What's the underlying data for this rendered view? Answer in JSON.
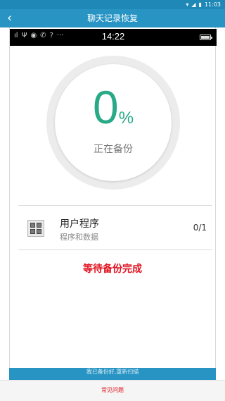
{
  "status_bar": {
    "time": "11:03",
    "icons": [
      "wifi-icon",
      "signal-icon",
      "battery-icon"
    ]
  },
  "header": {
    "back_icon": "‹",
    "title": "聊天记录恢复"
  },
  "phone_screenshot": {
    "time": "14:22",
    "left_icons": [
      "ıl",
      "Ψ",
      "◉",
      "✆",
      "?",
      "···"
    ]
  },
  "progress": {
    "value": "0",
    "unit": "%",
    "percent": 0,
    "status": "正在备份",
    "accent_color": "#28a987"
  },
  "backup_item": {
    "title": "用户程序",
    "subtitle": "程序和数据",
    "count": "0/1"
  },
  "wait_message": "等待备份完成",
  "bottom_button": {
    "label": "我已备份好,重新扫描"
  },
  "faq_link": "常见问题",
  "colors": {
    "header_bg": "#2794c4",
    "status_bg": "#1f88b7",
    "alert_red": "#e0121e"
  }
}
